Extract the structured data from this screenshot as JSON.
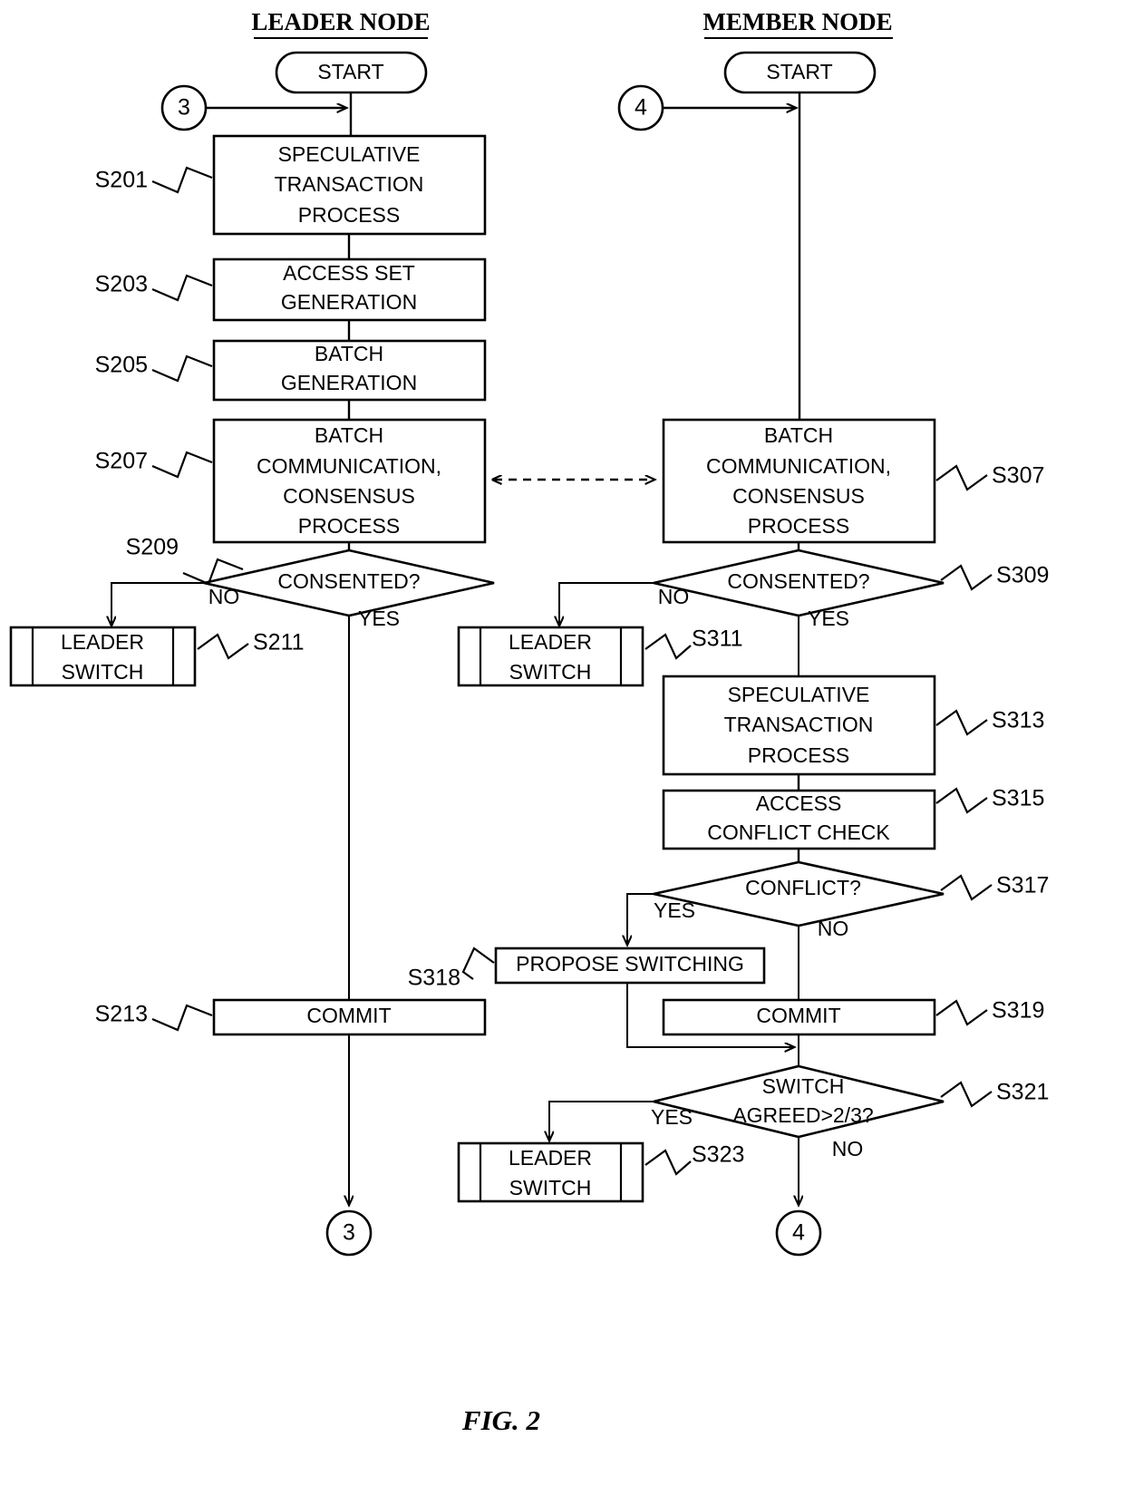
{
  "figure": {
    "caption": "FIG. 2"
  },
  "columns": {
    "leader": {
      "header": "LEADER NODE"
    },
    "member": {
      "header": "MEMBER NODE"
    }
  },
  "leader": {
    "start": {
      "label": "START"
    },
    "entry_connector": {
      "label": "3"
    },
    "exit_connector": {
      "label": "3"
    },
    "steps": [
      {
        "id": "S201",
        "step_label": "S201",
        "text": "SPECULATIVE TRANSACTION PROCESS",
        "lines": [
          "SPECULATIVE",
          "TRANSACTION",
          "PROCESS"
        ],
        "shape": "process"
      },
      {
        "id": "S203",
        "step_label": "S203",
        "text": "ACCESS SET GENERATION",
        "lines": [
          "ACCESS SET",
          "GENERATION"
        ],
        "shape": "process"
      },
      {
        "id": "S205",
        "step_label": "S205",
        "text": "BATCH GENERATION",
        "lines": [
          "BATCH",
          "GENERATION"
        ],
        "shape": "process"
      },
      {
        "id": "S207",
        "step_label": "S207",
        "text": "BATCH COMMUNICATION, CONSENSUS PROCESS",
        "lines": [
          "BATCH",
          "COMMUNICATION,",
          "CONSENSUS",
          "PROCESS"
        ],
        "shape": "process"
      },
      {
        "id": "S209",
        "step_label": "S209",
        "text": "CONSENTED?",
        "lines": [
          "CONSENTED?"
        ],
        "shape": "decision",
        "branch_no": "NO",
        "branch_yes": "YES"
      },
      {
        "id": "S211",
        "step_label": "S211",
        "text": "LEADER SWITCH",
        "lines": [
          "LEADER",
          "SWITCH"
        ],
        "shape": "predefined-process"
      },
      {
        "id": "S213",
        "step_label": "S213",
        "text": "COMMIT",
        "lines": [
          "COMMIT"
        ],
        "shape": "process"
      }
    ]
  },
  "member": {
    "start": {
      "label": "START"
    },
    "entry_connector": {
      "label": "4"
    },
    "exit_connector": {
      "label": "4"
    },
    "steps": [
      {
        "id": "S307",
        "step_label": "S307",
        "text": "BATCH COMMUNICATION, CONSENSUS PROCESS",
        "lines": [
          "BATCH",
          "COMMUNICATION,",
          "CONSENSUS",
          "PROCESS"
        ],
        "shape": "process"
      },
      {
        "id": "S309",
        "step_label": "S309",
        "text": "CONSENTED?",
        "lines": [
          "CONSENTED?"
        ],
        "shape": "decision",
        "branch_no": "NO",
        "branch_yes": "YES"
      },
      {
        "id": "S311",
        "step_label": "S311",
        "text": "LEADER SWITCH",
        "lines": [
          "LEADER",
          "SWITCH"
        ],
        "shape": "predefined-process"
      },
      {
        "id": "S313",
        "step_label": "S313",
        "text": "SPECULATIVE TRANSACTION PROCESS",
        "lines": [
          "SPECULATIVE",
          "TRANSACTION",
          "PROCESS"
        ],
        "shape": "process"
      },
      {
        "id": "S315",
        "step_label": "S315",
        "text": "ACCESS CONFLICT CHECK",
        "lines": [
          "ACCESS",
          "CONFLICT CHECK"
        ],
        "shape": "process"
      },
      {
        "id": "S317",
        "step_label": "S317",
        "text": "CONFLICT?",
        "lines": [
          "CONFLICT?"
        ],
        "shape": "decision",
        "branch_yes": "YES",
        "branch_no": "NO"
      },
      {
        "id": "S318",
        "step_label": "S318",
        "text": "PROPOSE SWITCHING",
        "lines": [
          "PROPOSE SWITCHING"
        ],
        "shape": "process"
      },
      {
        "id": "S319",
        "step_label": "S319",
        "text": "COMMIT",
        "lines": [
          "COMMIT"
        ],
        "shape": "process"
      },
      {
        "id": "S321",
        "step_label": "S321",
        "text": "SWITCH AGREED>2/3?",
        "lines": [
          "SWITCH",
          "AGREED>2/3?"
        ],
        "shape": "decision",
        "branch_yes": "YES",
        "branch_no": "NO"
      },
      {
        "id": "S323",
        "step_label": "S323",
        "text": "LEADER SWITCH",
        "lines": [
          "LEADER",
          "SWITCH"
        ],
        "shape": "predefined-process"
      }
    ]
  },
  "connector_dashed": {
    "label": "",
    "style": "bidirectional-dashed"
  },
  "colors": {
    "line": "#000000",
    "fill": "#ffffff",
    "text": "#000000"
  }
}
